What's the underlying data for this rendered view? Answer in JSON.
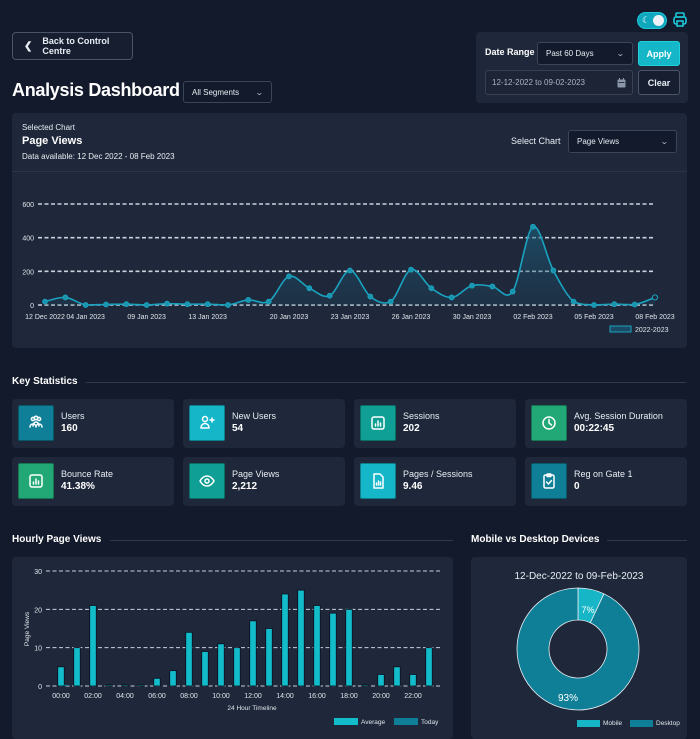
{
  "header": {
    "back_label": "Back to Control Centre",
    "title": "Analysis Dashboard",
    "segment_select": "All Segments",
    "theme_toggle": "dark",
    "print_icon": "printer-icon"
  },
  "date_range": {
    "label": "Date Range",
    "preset": "Past 60 Days",
    "apply_label": "Apply",
    "range_value": "12-12-2022 to 09-02-2023",
    "clear_label": "Clear"
  },
  "selected_chart": {
    "caption": "Selected Chart",
    "title": "Page Views",
    "availability": "Data available: 12 Dec 2022 - 08 Feb 2023",
    "select_label": "Select Chart",
    "select_value": "Page Views"
  },
  "colors": {
    "accent": "#14b6c8",
    "background": "#131a2b",
    "card": "#1f283a",
    "line": "#1aa3c0",
    "desktop": "#0e7f96",
    "mobile": "#16b6c6"
  },
  "key_statistics": {
    "title": "Key Statistics",
    "cards": [
      {
        "label": "Users",
        "value": "160",
        "icon": "users-group-icon",
        "color": "#0e7f96"
      },
      {
        "label": "New Users",
        "value": "54",
        "icon": "user-plus-icon",
        "color": "#14b6c8"
      },
      {
        "label": "Sessions",
        "value": "202",
        "icon": "bar-chart-icon",
        "color": "#0f9f94"
      },
      {
        "label": "Avg. Session Duration",
        "value": "00:22:45",
        "icon": "clock-icon",
        "color": "#22a876"
      },
      {
        "label": "Bounce Rate",
        "value": "41.38%",
        "icon": "bar-chart-icon",
        "color": "#22a876"
      },
      {
        "label": "Page Views",
        "value": "2,212",
        "icon": "eye-icon",
        "color": "#0f9f94"
      },
      {
        "label": "Pages / Sessions",
        "value": "9.46",
        "icon": "document-chart-icon",
        "color": "#14b6c8"
      },
      {
        "label": "Reg on Gate 1",
        "value": "0",
        "icon": "clipboard-check-icon",
        "color": "#0e7f96"
      }
    ]
  },
  "hourly": {
    "title": "Hourly Page Views"
  },
  "devices": {
    "title": "Mobile vs Desktop Devices",
    "range": "12-Dec-2022 to 09-Feb-2023"
  },
  "chart_data": [
    {
      "type": "area",
      "title": "Page Views",
      "xlabel": "",
      "ylabel": "",
      "ylim": [
        0,
        600
      ],
      "yticks": [
        0,
        200,
        400,
        600
      ],
      "grid": true,
      "legend": "bottom-right",
      "x_tick_labels": [
        "12 Dec 2022",
        "04 Jan 2023",
        "09 Jan 2023",
        "13 Jan 2023",
        "20 Jan 2023",
        "23 Jan 2023",
        "26 Jan 2023",
        "30 Jan 2023",
        "02 Feb 2023",
        "05 Feb 2023",
        "08 Feb 2023"
      ],
      "series": [
        {
          "name": "2022-2023",
          "values": [
            20,
            45,
            0,
            3,
            5,
            0,
            8,
            5,
            5,
            0,
            30,
            20,
            170,
            100,
            55,
            205,
            50,
            20,
            210,
            100,
            45,
            115,
            110,
            80,
            465,
            205,
            20,
            0,
            5,
            3,
            45
          ]
        }
      ]
    },
    {
      "type": "bar",
      "title": "Hourly Page Views",
      "xlabel": "24 Hour Timeline",
      "ylabel": "Page Views",
      "ylim": [
        0,
        30
      ],
      "yticks": [
        0,
        10,
        20,
        30
      ],
      "grid": true,
      "legend": "bottom-right",
      "categories": [
        "00:00",
        "01:00",
        "02:00",
        "03:00",
        "04:00",
        "05:00",
        "06:00",
        "07:00",
        "08:00",
        "09:00",
        "10:00",
        "11:00",
        "12:00",
        "13:00",
        "14:00",
        "15:00",
        "16:00",
        "17:00",
        "18:00",
        "19:00",
        "20:00",
        "21:00",
        "22:00",
        "23:00"
      ],
      "x_tick_labels": [
        "00:00",
        "02:00",
        "04:00",
        "06:00",
        "08:00",
        "10:00",
        "12:00",
        "14:00",
        "16:00",
        "18:00",
        "20:00",
        "22:00"
      ],
      "series": [
        {
          "name": "Average",
          "values": [
            5,
            10,
            21,
            0.3,
            0.3,
            0.3,
            2,
            4,
            14,
            9,
            11,
            10,
            17,
            15,
            24,
            25,
            21,
            19,
            20,
            0.3,
            3,
            5,
            3,
            10
          ]
        },
        {
          "name": "Today",
          "values": [
            0.3,
            0,
            0,
            0,
            0,
            0,
            0,
            0,
            0,
            0,
            0,
            0,
            0,
            0,
            0,
            0,
            0,
            0,
            0,
            0,
            0,
            0,
            0,
            0
          ]
        }
      ]
    },
    {
      "type": "pie",
      "title": "12-Dec-2022 to 09-Feb-2023",
      "legend": "bottom-right",
      "categories": [
        "Mobile",
        "Desktop"
      ],
      "values": [
        7,
        93
      ],
      "labels": [
        "7%",
        "93%"
      ]
    }
  ]
}
